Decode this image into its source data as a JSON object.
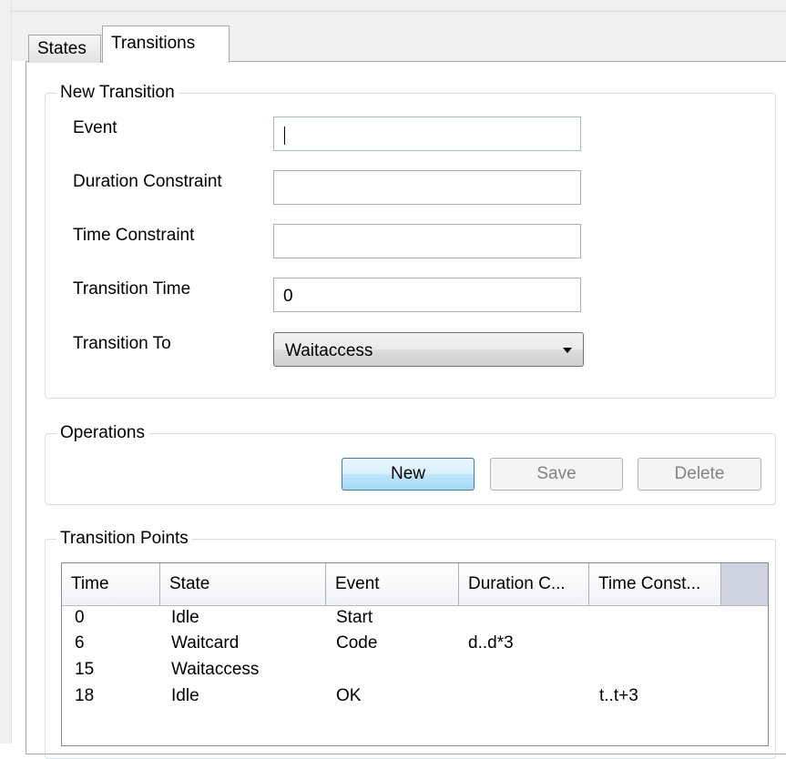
{
  "tabs": [
    {
      "label": "States",
      "selected": false
    },
    {
      "label": "Transitions",
      "selected": true
    }
  ],
  "new_transition": {
    "title": "New Transition",
    "event": {
      "label": "Event",
      "value": ""
    },
    "duration_constraint": {
      "label": "Duration Constraint",
      "value": ""
    },
    "time_constraint": {
      "label": "Time Constraint",
      "value": ""
    },
    "transition_time": {
      "label": "Transition Time",
      "value": "0"
    },
    "transition_to": {
      "label": "Transition To",
      "value": "Waitaccess"
    }
  },
  "operations": {
    "title": "Operations",
    "new_label": "New",
    "save_label": "Save",
    "delete_label": "Delete"
  },
  "transition_points": {
    "title": "Transition Points",
    "columns": [
      "Time",
      "State",
      "Event",
      "Duration C...",
      "Time Const..."
    ],
    "rows": [
      [
        "0",
        "Idle",
        "Start",
        "",
        ""
      ],
      [
        "6",
        "Waitcard",
        "Code",
        "d..d*3",
        ""
      ],
      [
        "15",
        "Waitaccess",
        "",
        "",
        ""
      ],
      [
        "18",
        "Idle",
        "OK",
        "",
        "t..t+3"
      ]
    ]
  },
  "colors": {
    "header_bg": "#d0d4e1",
    "button_border": "#3c7fb1",
    "disabled_text": "#838383"
  }
}
